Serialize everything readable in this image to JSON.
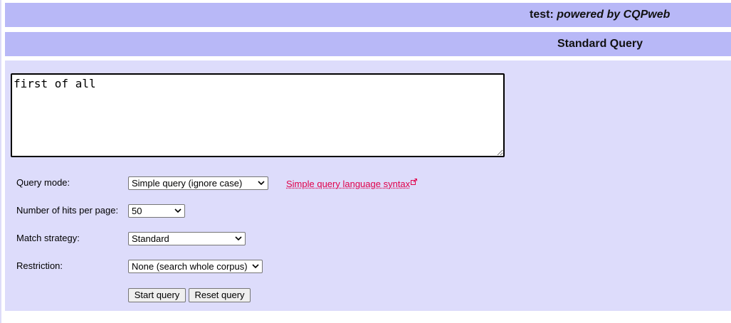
{
  "header": {
    "title_prefix": "test: ",
    "title_emphasis": "powered by CQPweb"
  },
  "section": {
    "title": "Standard Query"
  },
  "query": {
    "text": "first of all"
  },
  "form": {
    "query_mode": {
      "label": "Query mode:",
      "selected": "Simple query (ignore case)"
    },
    "syntax_link": {
      "label": "Simple query language syntax"
    },
    "hits_per_page": {
      "label": "Number of hits per page:",
      "selected": "50"
    },
    "match_strategy": {
      "label": "Match strategy:",
      "selected": "Standard"
    },
    "restriction": {
      "label": "Restriction:",
      "selected": "None (search whole corpus)"
    },
    "buttons": {
      "start": "Start query",
      "reset": "Reset query"
    }
  },
  "colors": {
    "bar": "#b8b8f7",
    "panel": "#dddcfb",
    "link": "#e0004a"
  },
  "icons": {
    "external_link": "external-link-icon",
    "dropdown": "chevron-down-icon"
  }
}
